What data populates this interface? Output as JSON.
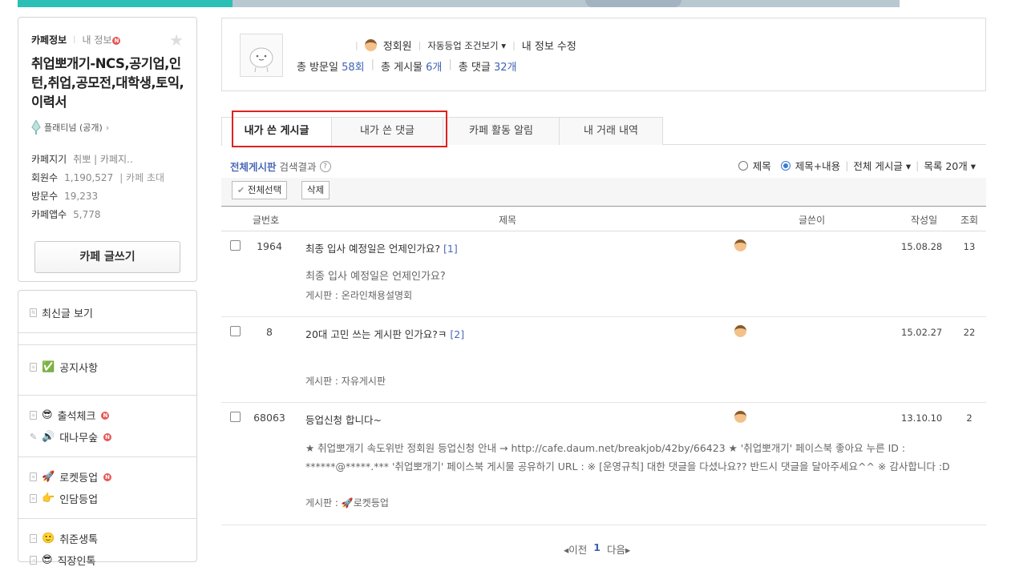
{
  "cafe": {
    "tab_info": "카페정보",
    "tab_my": "내 정보",
    "new_badge": "N",
    "name": "취업뽀개기-NCS,공기업,인턴,취업,공모전,대학생,토익,이력서",
    "grade": "플래티넘 (공개)",
    "info": [
      {
        "k": "카페지기",
        "v": "취뽀 | 카페지..",
        "sub": ""
      },
      {
        "k": "회원수",
        "v": "1,190,527",
        "sub": "| 카페 초대"
      },
      {
        "k": "방문수",
        "v": "19,233",
        "sub": ""
      },
      {
        "k": "카페앱수",
        "v": "5,778",
        "sub": ""
      }
    ],
    "write_button": "카페 글쓰기"
  },
  "menu": {
    "latest": "최신글 보기",
    "notice": "공지사항",
    "attendance": "출석체크",
    "bamboo": "대나무숲",
    "rocket": "로켓등업",
    "indam": "인담등업",
    "jobprep": "취준생톡",
    "jobworker": "직장인톡"
  },
  "profile": {
    "nickname": "",
    "level": "정회원",
    "auto_levelup": "자동등업 조건보기 ▾",
    "edit_info": "내 정보 수정",
    "visits_label": "총 방문일",
    "visits_value": "58회",
    "posts_label": "총 게시물",
    "posts_value": "6개",
    "comments_label": "총 댓글",
    "comments_value": "32개"
  },
  "tabs": [
    "내가 쓴 게시글",
    "내가 쓴 댓글",
    "카페 활동 알림",
    "내 거래 내역"
  ],
  "search": {
    "board": "전체게시판",
    "result": "검색결과",
    "opt_title": "제목",
    "opt_title_content": "제목+내용",
    "all_boards": "전체 게시글 ▾",
    "list_size": "목록 20개 ▾"
  },
  "toolbar": {
    "select_all": "전체선택",
    "delete": "삭제"
  },
  "table_head": {
    "num": "글번호",
    "subject": "제목",
    "writer": "글쓴이",
    "date": "작성일",
    "views": "조회"
  },
  "posts": [
    {
      "num": "1964",
      "subject": "최종 입사 예정일은 언제인가요?",
      "comments": "[1]",
      "date": "15.08.28",
      "views": "13",
      "preview": "최종 입사 예정일은 언제인가요?",
      "board": "게시판 : 온라인채용설명회"
    },
    {
      "num": "8",
      "subject": "20대 고민 쓰는 게시판 인가요?ㅋ",
      "comments": "[2]",
      "date": "15.02.27",
      "views": "22",
      "preview": "",
      "board": "게시판 : 자유게시판"
    },
    {
      "num": "68063",
      "subject": "등업신청 합니다~",
      "comments": "",
      "date": "13.10.10",
      "views": "2",
      "preview": "★ 취업뽀개기 속도위반 정회원 등업신청 안내 → http://cafe.daum.net/breakjob/42by/66423 ★ '취업뽀개기' 페이스북 좋아요 누른 ID : ******@*****.*** '취업뽀개기' 페이스북 게시물 공유하기 URL : ※ [운영규칙] 대한 댓글을 다셨나요?? 반드시 댓글을 달아주세요^^ ※ 감사합니다 :D",
      "board": "게시판 : 🚀로켓등업"
    }
  ],
  "pager": {
    "prev": "◂이전",
    "page": "1",
    "next": "다음▸"
  }
}
